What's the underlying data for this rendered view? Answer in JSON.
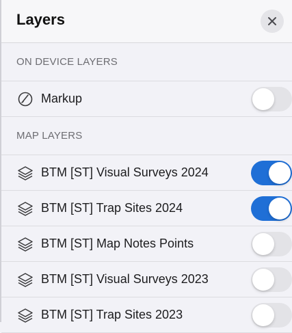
{
  "header": {
    "title": "Layers",
    "close_icon": "close-icon"
  },
  "on_device_section": {
    "title": "ON DEVICE LAYERS",
    "items": [
      {
        "label": "Markup",
        "icon": "markup-icon",
        "enabled": false
      }
    ]
  },
  "map_layers_section": {
    "title": "MAP LAYERS",
    "items": [
      {
        "label": "BTM [ST] Visual Surveys 2024",
        "icon": "layers-icon",
        "enabled": true
      },
      {
        "label": "BTM [ST] Trap Sites 2024",
        "icon": "layers-icon",
        "enabled": true
      },
      {
        "label": "BTM [ST] Map Notes Points",
        "icon": "layers-icon",
        "enabled": false
      },
      {
        "label": "BTM [ST] Visual Surveys 2023",
        "icon": "layers-icon",
        "enabled": false
      },
      {
        "label": "BTM [ST] Trap Sites 2023",
        "icon": "layers-icon",
        "enabled": false
      }
    ]
  },
  "colors": {
    "toggle_on": "#1f6fd6",
    "toggle_off": "#e3e3e7",
    "background": "#f2f2f7"
  }
}
